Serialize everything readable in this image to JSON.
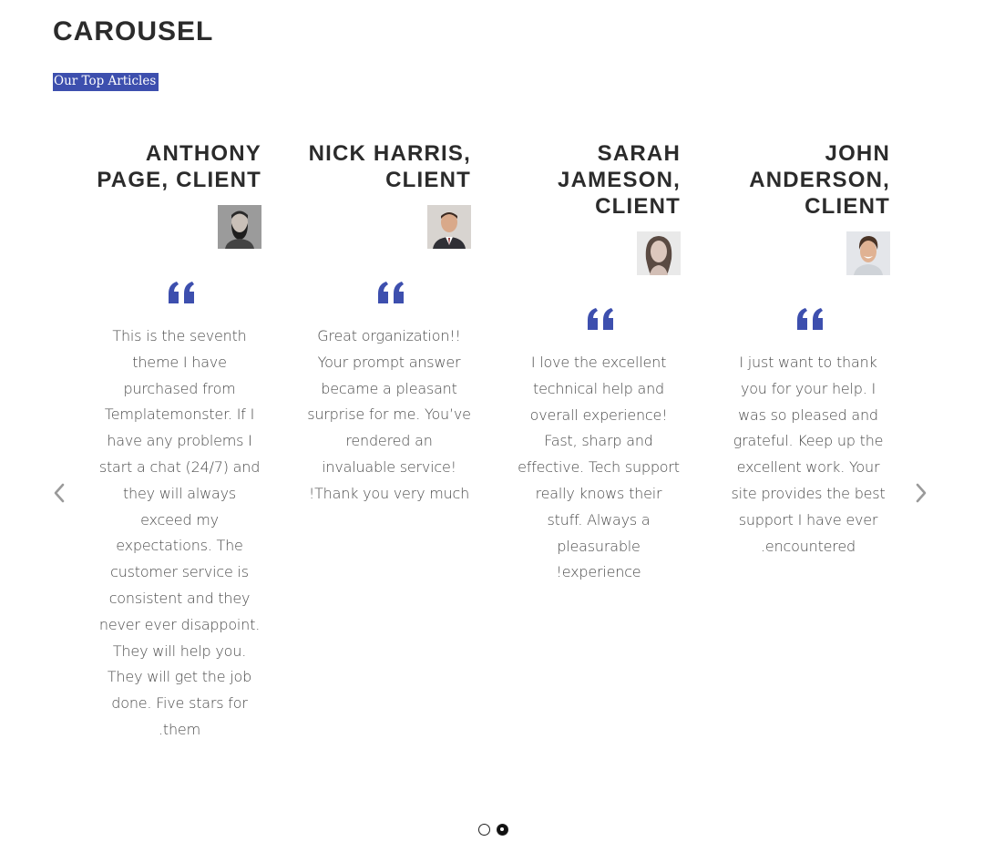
{
  "page": {
    "title": "CAROUSEL",
    "subtitle": "Our Top Articles"
  },
  "carousel": {
    "prev_icon": "chevron-left-icon",
    "next_icon": "chevron-right-icon",
    "quote_icon": "quote-icon",
    "accent_color": "#3d4fae",
    "slides": [
      {
        "name": "ANTHONY PAGE, CLIENT",
        "text": "This is the seventh theme I have purchased from Templatemonster. If I have any problems I start a chat (24/7) and they will always exceed my expectations. The customer service is consistent and they never ever disappoint. They will help you. They will get the job done. Five stars for .them"
      },
      {
        "name": "NICK HARRIS, CLIENT",
        "text": "Great organization!! Your prompt answer became a pleasant surprise for me. You’ve rendered an invaluable service! !Thank you very much"
      },
      {
        "name": "SARAH JAMESON, CLIENT",
        "text": "I love the excellent technical help and overall experience! Fast, sharp and effective. Tech support really knows their stuff. Always a pleasurable !experience"
      },
      {
        "name": "JOHN ANDERSON, CLIENT",
        "text": "I just want to thank you for your help. I was so pleased and grateful. Keep up the excellent work. Your site provides the best support I have ever .encountered"
      }
    ],
    "pagination": {
      "total": 2,
      "active": 2
    }
  }
}
